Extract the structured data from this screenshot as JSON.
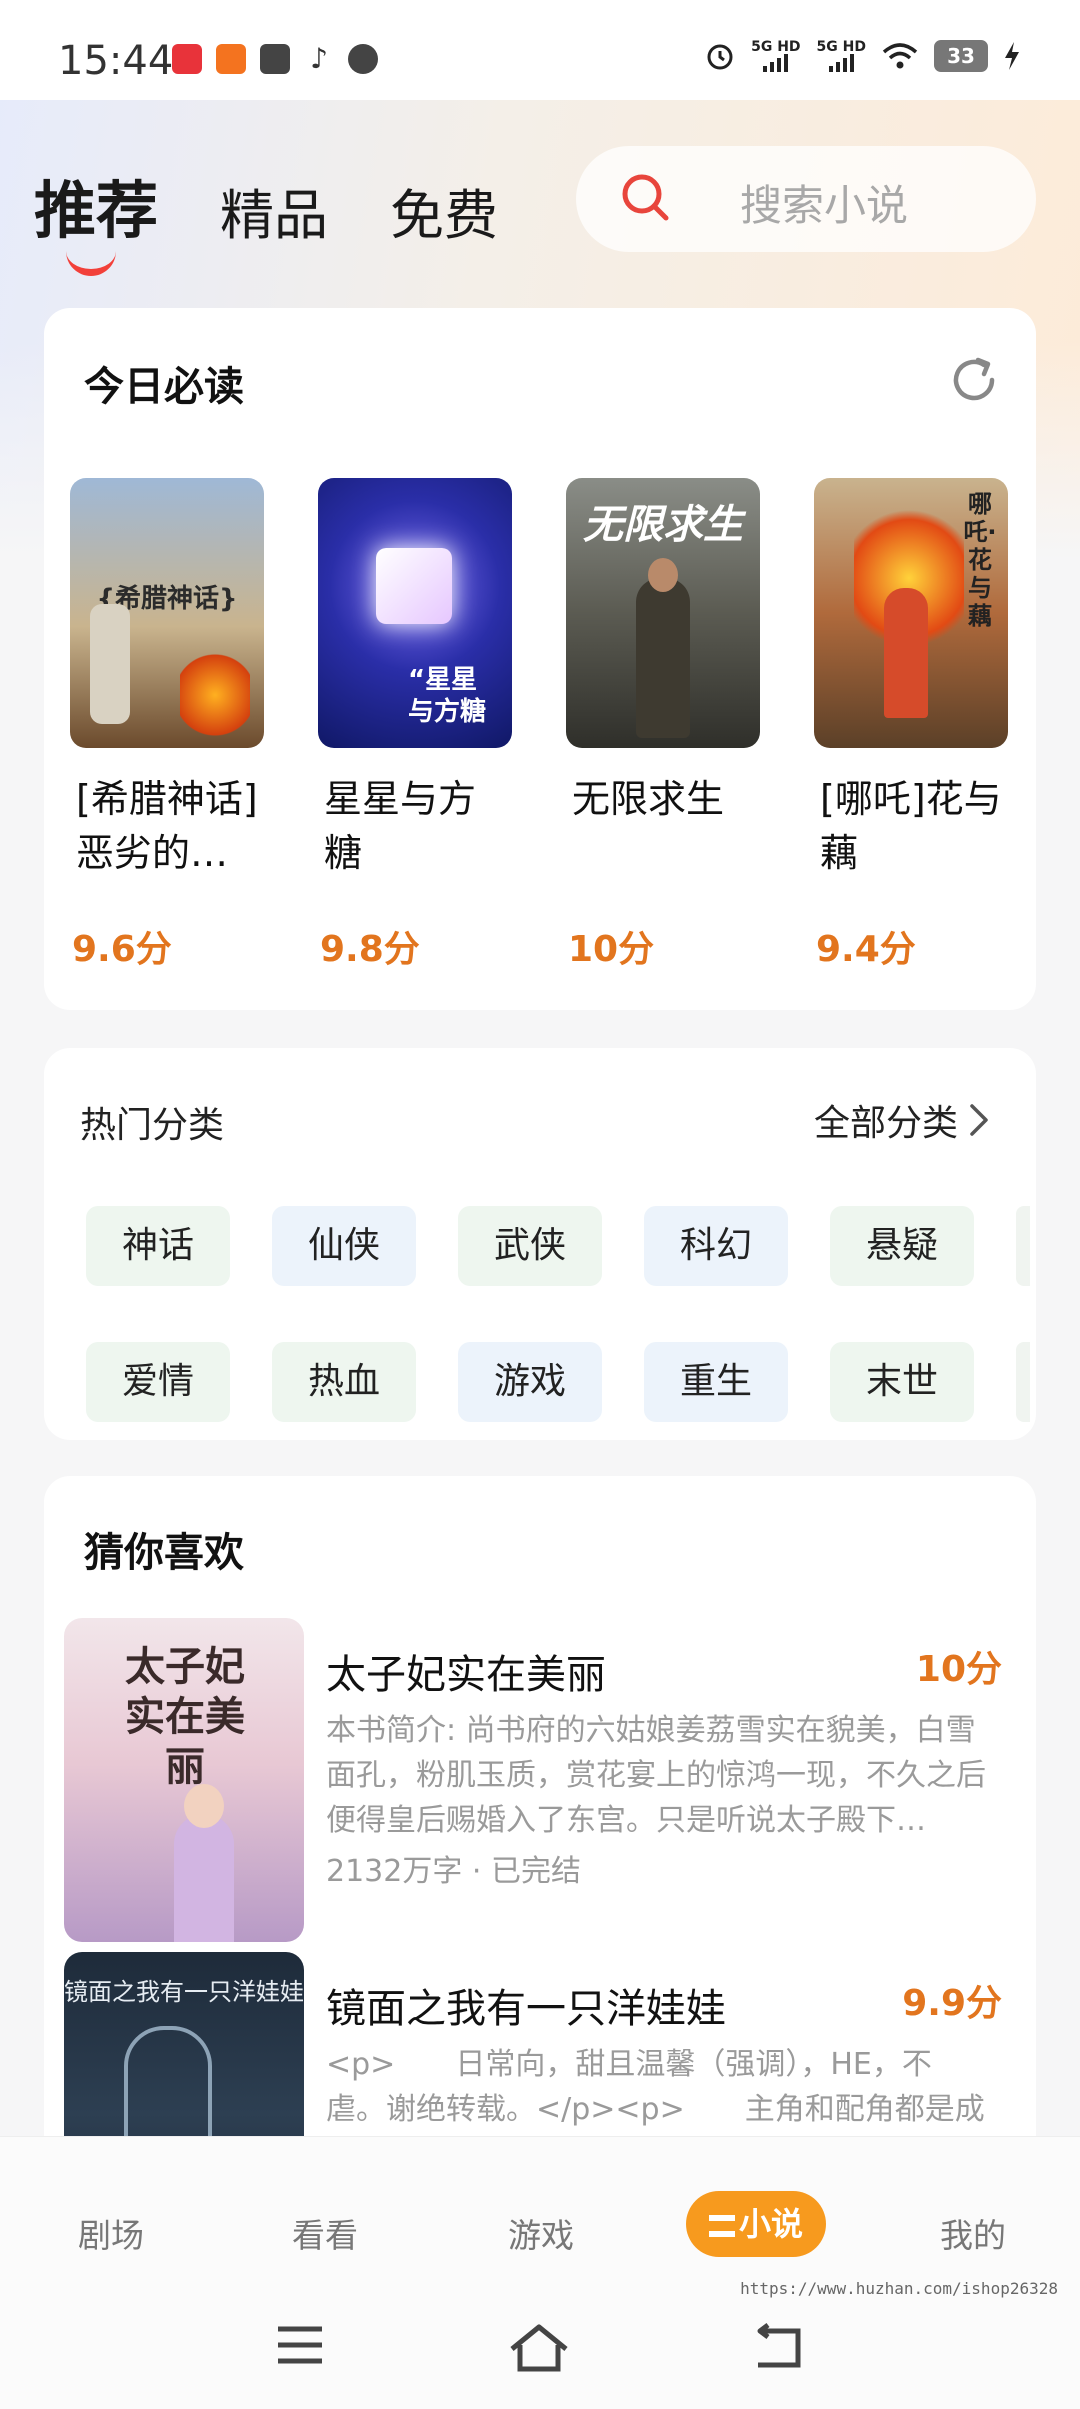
{
  "status_bar": {
    "time": "15:44",
    "network1": "5G HD",
    "network2": "5G HD",
    "battery": "33"
  },
  "top_tabs": [
    "推荐",
    "精品",
    "免费"
  ],
  "search": {
    "placeholder": "搜索小说"
  },
  "today": {
    "title": "今日必读",
    "books": [
      {
        "name": "[希腊神话]恶劣的…",
        "name_l1": "[希腊神话]",
        "name_l2": "恶劣的…",
        "score": "9.6分",
        "cover_text": "{希腊神话}"
      },
      {
        "name": "星星与方糖",
        "name_l1": "星星与方",
        "name_l2": "糖",
        "score": "9.8分",
        "cover_text": "“星星与方糖"
      },
      {
        "name": "无限求生",
        "name_l1": "无限求生",
        "name_l2": "",
        "score": "10分",
        "cover_text": "无限求生"
      },
      {
        "name": "[哪吒]花与藕",
        "name_l1": "[哪吒]花与",
        "name_l2": "藕",
        "score": "9.4分",
        "cover_text": "哪吒·花与藕"
      }
    ]
  },
  "hot": {
    "title": "热门分类",
    "all_label": "全部分类",
    "row1": [
      "神话",
      "仙侠",
      "武侠",
      "科幻",
      "悬疑"
    ],
    "row2": [
      "爱情",
      "热血",
      "游戏",
      "重生",
      "末世"
    ]
  },
  "guess": {
    "title": "猜你喜欢",
    "items": [
      {
        "title": "太子妃实在美丽",
        "score": "10分",
        "desc": "本书简介: 尚书府的六姑娘姜荔雪实在貌美，白雪面孔，粉肌玉质，赏花宴上的惊鸿一现，不久之后便得皇后赐婚入了东宫。只是听说太子殿下…",
        "meta": "2132万字 · 已完结",
        "cover_text": "太子妃实在美丽"
      },
      {
        "title": "镜面之我有一只洋娃娃",
        "score": "9.9分",
        "desc": "<p>　　日常向，甜且温馨（强调），HE，不虐。谢绝转载。</p><p>　　主角和配角都是成长型",
        "meta": "",
        "cover_text": "镜面之我有一只洋娃娃"
      }
    ]
  },
  "bottom_nav": [
    "剧场",
    "看看",
    "游戏",
    "小说",
    "我的"
  ],
  "watermark": "https://www.huzhan.com/ishop26328",
  "colors": {
    "accent_orange": "#e2751e",
    "active_tab": "#f79a1e",
    "tab_underline": "#f2403a"
  }
}
